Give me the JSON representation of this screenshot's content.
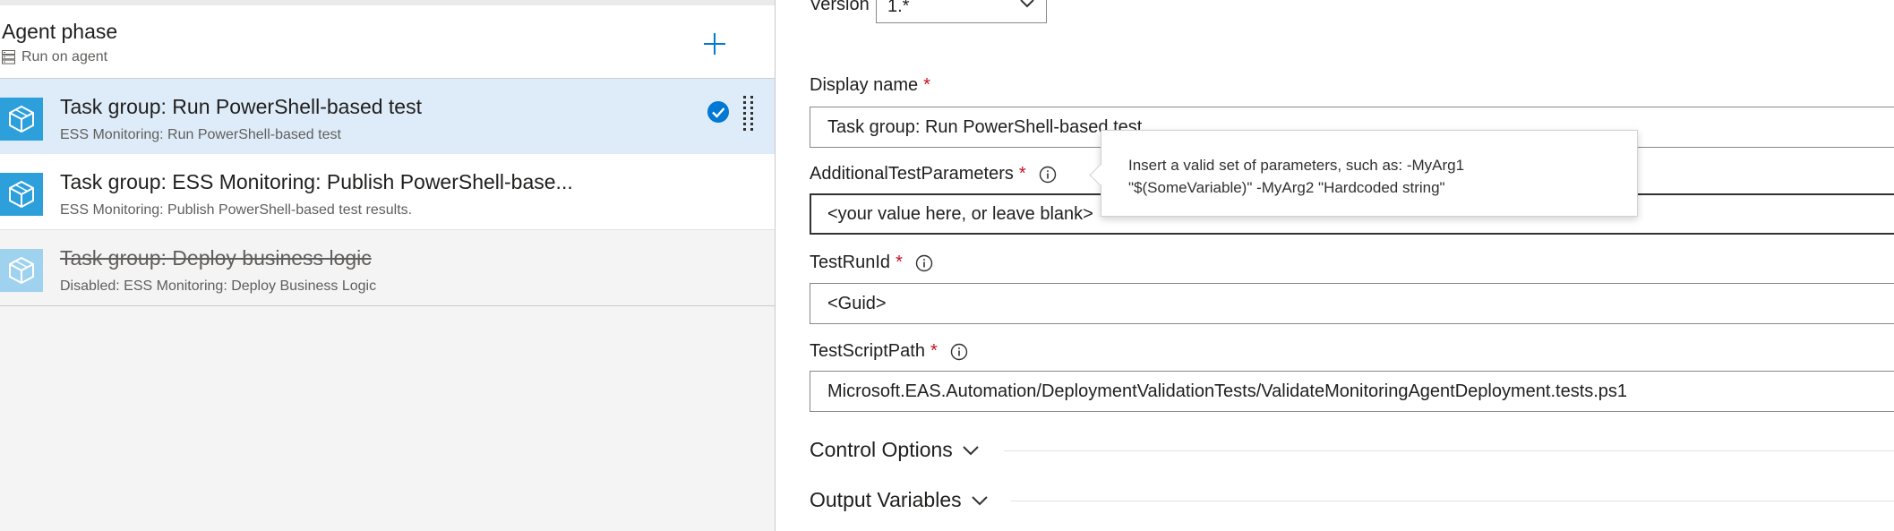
{
  "phase": {
    "title": "Agent phase",
    "subtitle": "Run on agent",
    "add_icon": "plus-icon",
    "server_icon": "server-icon"
  },
  "tasks": [
    {
      "title": "Task group: Run PowerShell-based test",
      "subtitle": "ESS Monitoring: Run PowerShell-based test",
      "state": "selected"
    },
    {
      "title": "Task group: ESS Monitoring: Publish PowerShell-base...",
      "subtitle": "ESS Monitoring: Publish PowerShell-based test results.",
      "state": "enabled"
    },
    {
      "title": "Task group: Deploy business logic",
      "subtitle": "Disabled: ESS Monitoring: Deploy Business Logic",
      "state": "disabled"
    }
  ],
  "form": {
    "version_label": "Version",
    "version_value": "1.*",
    "display_name": {
      "label": "Display name",
      "required": "*",
      "value": "Task group: Run PowerShell-based test"
    },
    "additional_params": {
      "label": "AdditionalTestParameters",
      "required": "*",
      "value": "<your value here, or leave blank>"
    },
    "test_run_id": {
      "label": "TestRunId",
      "required": "*",
      "value": "<Guid>"
    },
    "test_script_path": {
      "label": "TestScriptPath",
      "required": "*",
      "value": "Microsoft.EAS.Automation/DeploymentValidationTests/ValidateMonitoringAgentDeployment.tests.ps1"
    }
  },
  "sections": {
    "control_options": "Control Options",
    "output_variables": "Output Variables"
  },
  "tooltip": {
    "line1": "Insert a valid set of parameters, such as: -MyArg1",
    "line2": "\"$(SomeVariable)\" -MyArg2 \"Hardcoded string\""
  },
  "colors": {
    "accent": "#0078d4",
    "selected_row": "#deecf9",
    "task_icon": "#2d9fdb",
    "required": "#c50f1f"
  }
}
